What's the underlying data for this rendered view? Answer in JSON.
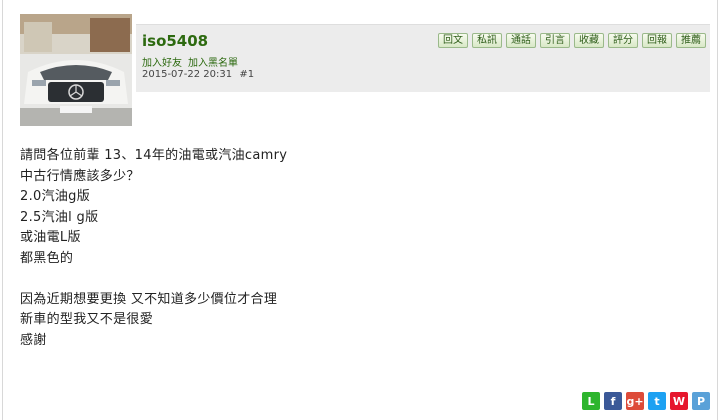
{
  "post": {
    "username": "iso5408",
    "add_friend": "加入好友",
    "add_blacklist": "加入黑名單",
    "datetime": "2015-07-22 20:31",
    "post_number": "#1"
  },
  "toolbar": {
    "buttons": [
      "回文",
      "私訊",
      "通話",
      "引言",
      "收藏",
      "評分",
      "回報",
      "推薦"
    ]
  },
  "content": {
    "lines": [
      "請問各位前輩  13、14年的油電或汽油camry",
      "中古行情應該多少？",
      "2.0汽油g版",
      "2.5汽油l g版",
      "或油電L版",
      "都黑色的",
      "",
      "因為近期想要更換 又不知道多少價位才合理",
      "新車的型我又不是很愛",
      "感謝"
    ]
  },
  "share": {
    "icons": [
      {
        "name": "line-share-icon",
        "glyph": "L",
        "color": "#2db52d"
      },
      {
        "name": "facebook-share-icon",
        "glyph": "f",
        "color": "#3b5998"
      },
      {
        "name": "googleplus-share-icon",
        "glyph": "g+",
        "color": "#dd4b39"
      },
      {
        "name": "twitter-share-icon",
        "glyph": "t",
        "color": "#1da1f2"
      },
      {
        "name": "weibo-share-icon",
        "glyph": "W",
        "color": "#e6162d"
      },
      {
        "name": "plurk-share-icon",
        "glyph": "P",
        "color": "#5aa1d8"
      }
    ]
  }
}
